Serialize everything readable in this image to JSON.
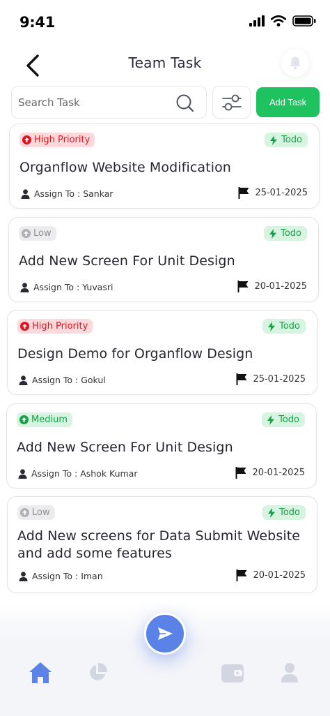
{
  "status_bar": {
    "time": "9:41"
  },
  "header": {
    "title": "Team Task"
  },
  "search": {
    "placeholder": "Search Task"
  },
  "toolbar": {
    "add_task_label": "Add Task"
  },
  "tasks": [
    {
      "priority": "High Priority",
      "priority_level": "high",
      "status": "Todo",
      "title": "Organflow Website Modification",
      "assign": "Assign To : Sankar",
      "date": "25-01-2025"
    },
    {
      "priority": "Low",
      "priority_level": "low",
      "status": "Todo",
      "title": "Add New Screen For Unit Design",
      "assign": "Assign To : Yuvasri",
      "date": "20-01-2025"
    },
    {
      "priority": "High Priority",
      "priority_level": "high",
      "status": "Todo",
      "title": "Design Demo for Organflow Design",
      "assign": "Assign To : Gokul",
      "date": "25-01-2025"
    },
    {
      "priority": "Medium",
      "priority_level": "medium",
      "status": "Todo",
      "title": "Add New Screen For Unit Design",
      "assign": "Assign To : Ashok Kumar",
      "date": "20-01-2025"
    },
    {
      "priority": "Low",
      "priority_level": "low",
      "status": "Todo",
      "title": "Add New screens for Data Submit Website and add some features",
      "assign": "Assign To : Iman",
      "date": "20-01-2025"
    }
  ],
  "bottom_nav": {
    "items": [
      {
        "icon": "home-icon",
        "active": true
      },
      {
        "icon": "pie-chart-icon",
        "active": false
      },
      {
        "icon": "send-icon",
        "active": false
      },
      {
        "icon": "wallet-icon",
        "active": false
      },
      {
        "icon": "user-icon",
        "active": false
      }
    ]
  },
  "colors": {
    "accent_green": "#1ec35f",
    "high_priority": "#e0141e",
    "medium_priority": "#16a04a",
    "low_priority": "#8f8f94",
    "nav_active": "#5b82e6",
    "nav_inactive": "#d2d6e0"
  }
}
